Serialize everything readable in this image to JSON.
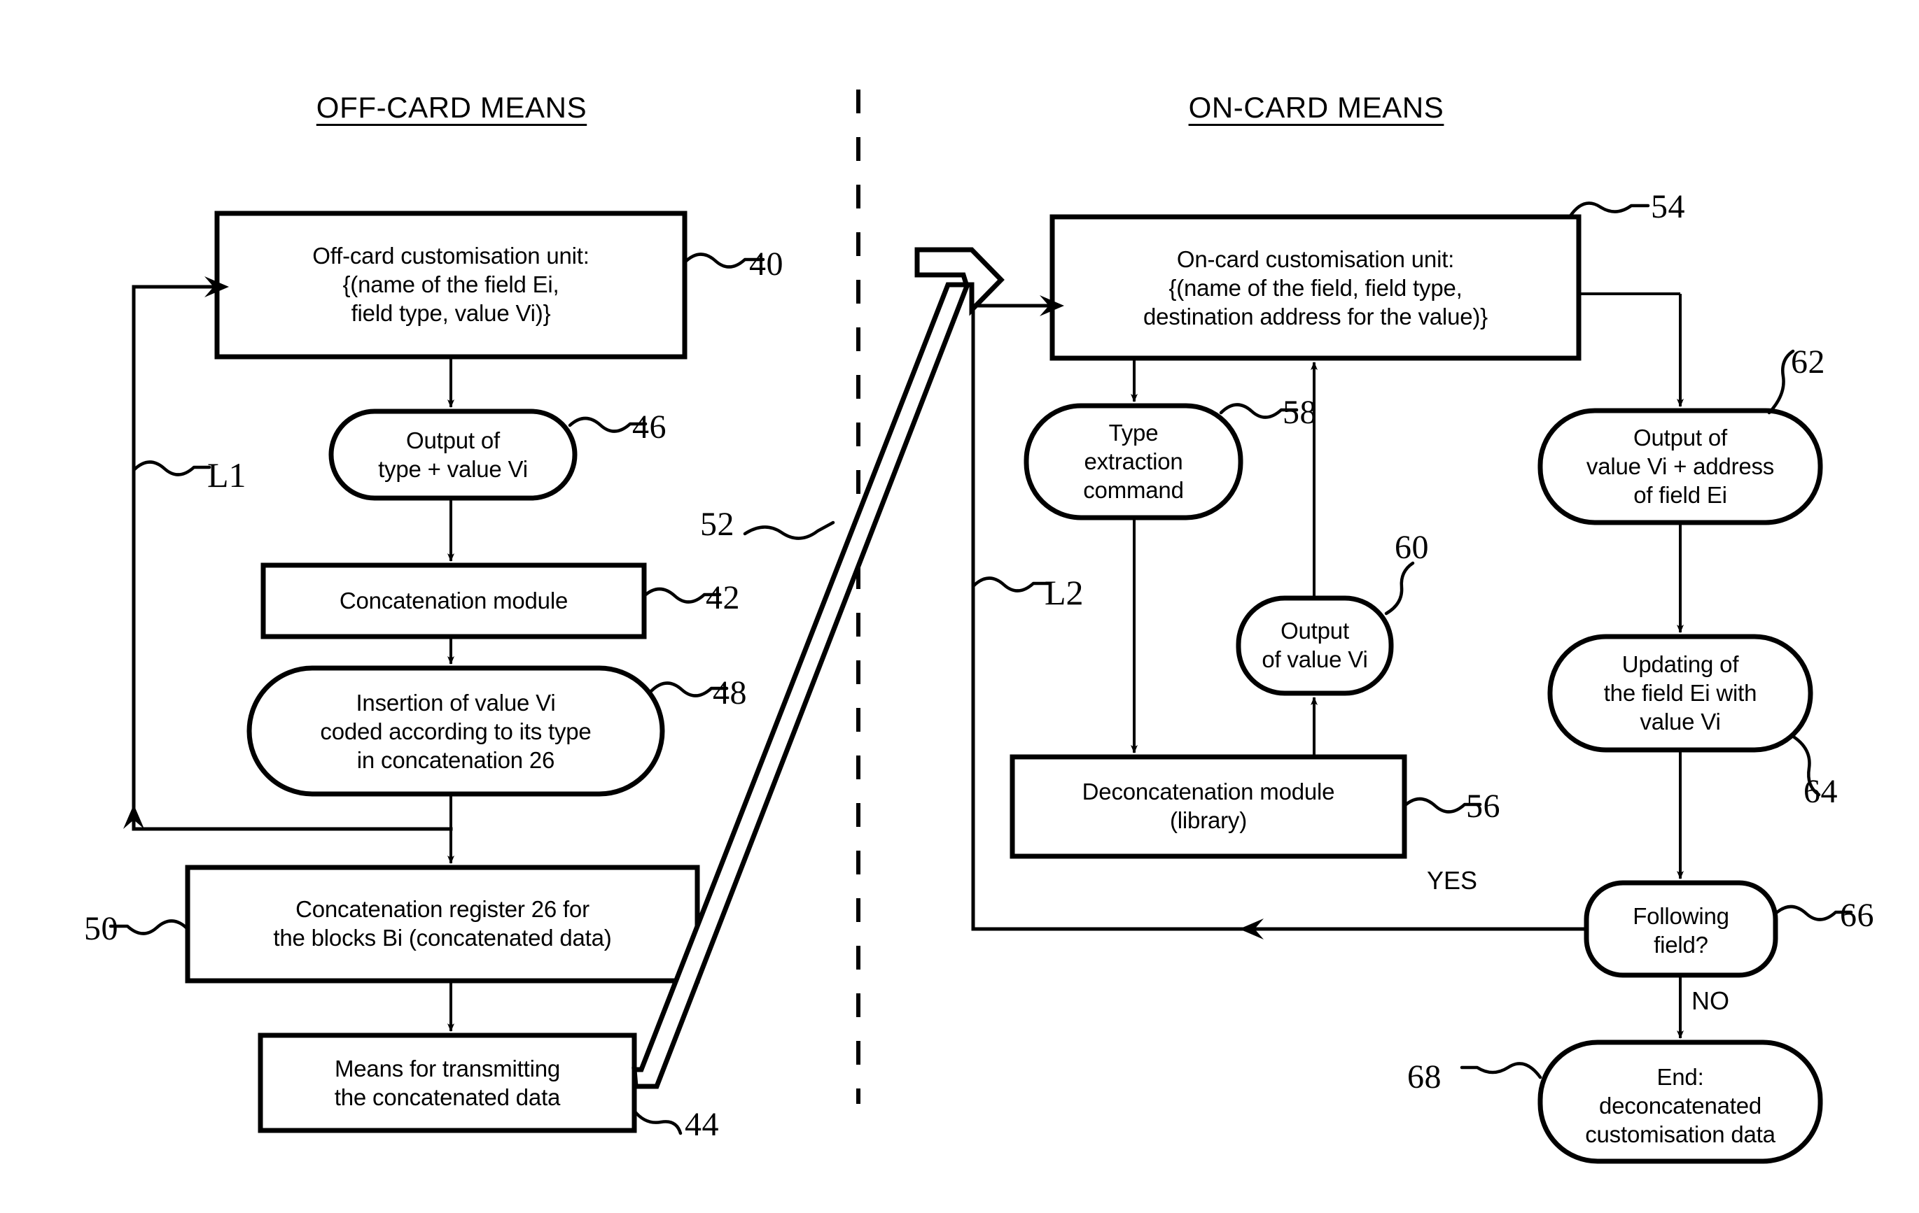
{
  "figure": {
    "type": "flowchart",
    "headings": {
      "left": "OFF-CARD MEANS",
      "right": "ON-CARD MEANS"
    },
    "divider": "vertical-dashed-line"
  },
  "nodes": {
    "off_card_unit": {
      "ref": "40",
      "shape": "rect",
      "text": "Off-card customisation unit:\n{(name of the field Ei,\nfield type, value Vi)}"
    },
    "output_type_value": {
      "ref": "46",
      "shape": "stadium",
      "text": "Output of\ntype + value Vi"
    },
    "concatenation_module": {
      "ref": "42",
      "shape": "rect",
      "text": "Concatenation module"
    },
    "insertion_value": {
      "ref": "48",
      "shape": "stadium",
      "text": "Insertion of value Vi\ncoded according to its type\nin concatenation 26"
    },
    "concatenation_register": {
      "ref": "50",
      "shape": "rect",
      "text": "Concatenation register 26 for\nthe blocks Bi (concatenated data)"
    },
    "transmitting_means": {
      "ref": "44",
      "shape": "rect",
      "text": "Means for transmitting\nthe concatenated data"
    },
    "on_card_unit": {
      "ref": "54",
      "shape": "rect",
      "text": "On-card customisation unit:\n{(name of the field, field type,\ndestination address for the value)}"
    },
    "type_extraction": {
      "ref": "58",
      "shape": "stadium",
      "text": "Type\nextraction\ncommand"
    },
    "output_value": {
      "ref": "60",
      "shape": "stadium",
      "text": "Output\nof value Vi"
    },
    "deconcatenation_module": {
      "ref": "56",
      "shape": "rect",
      "text": "Deconcatenation module\n(library)"
    },
    "output_value_address": {
      "ref": "62",
      "shape": "stadium",
      "text": "Output of\nvalue Vi + address\nof field Ei"
    },
    "updating_field": {
      "ref": "64",
      "shape": "stadium",
      "text": "Updating of\nthe field Ei with\nvalue Vi"
    },
    "following_field": {
      "ref": "66",
      "shape": "stadium-decision",
      "text": "Following\nfield?"
    },
    "end_node": {
      "ref": "68",
      "shape": "stadium",
      "text": "End:\ndeconcatenated\ncustomisation data"
    }
  },
  "connectors": {
    "transmission_ref": "52",
    "loop_left": "L1",
    "loop_right": "L2",
    "yes_label": "YES",
    "no_label": "NO"
  },
  "colors": {
    "ink": "#000000",
    "paper": "#ffffff"
  }
}
